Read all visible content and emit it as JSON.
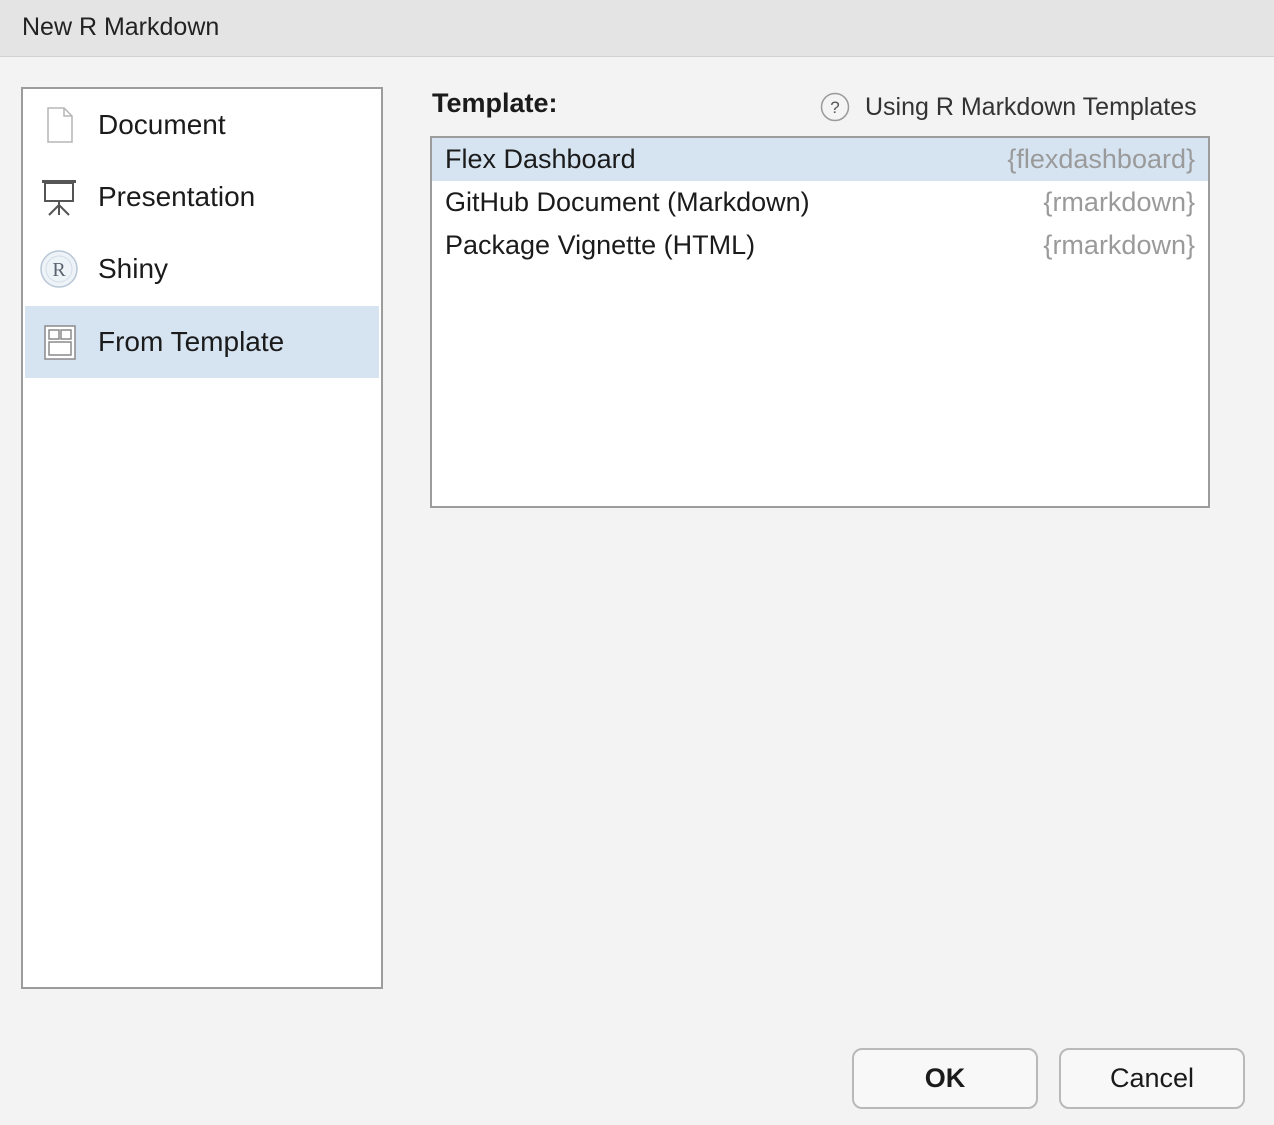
{
  "window": {
    "title": "New R Markdown"
  },
  "sidebar": {
    "items": [
      {
        "label": "Document",
        "icon": "document-icon",
        "selected": false
      },
      {
        "label": "Presentation",
        "icon": "presentation-icon",
        "selected": false
      },
      {
        "label": "Shiny",
        "icon": "shiny-r-icon",
        "selected": false
      },
      {
        "label": "From Template",
        "icon": "template-icon",
        "selected": true
      }
    ]
  },
  "main": {
    "template_heading": "Template:",
    "help_link": {
      "icon": "question-icon",
      "label": "Using R Markdown Templates"
    },
    "templates": [
      {
        "name": "Flex Dashboard",
        "package": "{flexdashboard}",
        "selected": true
      },
      {
        "name": "GitHub Document (Markdown)",
        "package": "{rmarkdown}",
        "selected": false
      },
      {
        "name": "Package Vignette (HTML)",
        "package": "{rmarkdown}",
        "selected": false
      }
    ]
  },
  "buttons": {
    "ok_label": "OK",
    "cancel_label": "Cancel"
  },
  "colors": {
    "selection": "#d6e4f2",
    "package_text": "#9a9a9a"
  }
}
